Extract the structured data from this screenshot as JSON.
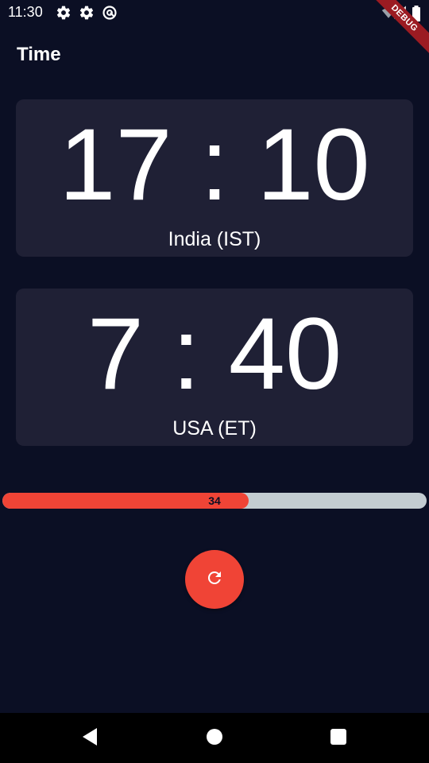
{
  "status_bar": {
    "time": "11:30",
    "left_icons": [
      "settings-icon",
      "settings-icon",
      "sync-icon"
    ],
    "right_icons": [
      "wifi-icon",
      "signal-icon",
      "battery-icon"
    ]
  },
  "debug_banner": "DEBUG",
  "app": {
    "title": "Time"
  },
  "clocks": [
    {
      "time": "17 : 10",
      "zone": "India (IST)"
    },
    {
      "time": "7 : 40",
      "zone": "USA (ET)"
    }
  ],
  "progress": {
    "value_label": "34",
    "fraction": 0.58,
    "fill_color": "#f04436",
    "track_color": "#c3ccd1"
  },
  "refresh_button": {
    "icon": "refresh-icon",
    "color": "#f04436"
  },
  "nav_bar": {
    "buttons": [
      "back-icon",
      "home-icon",
      "recents-icon"
    ]
  },
  "colors": {
    "background": "#0b0f24",
    "card": "#1f2035",
    "accent": "#f04436"
  }
}
